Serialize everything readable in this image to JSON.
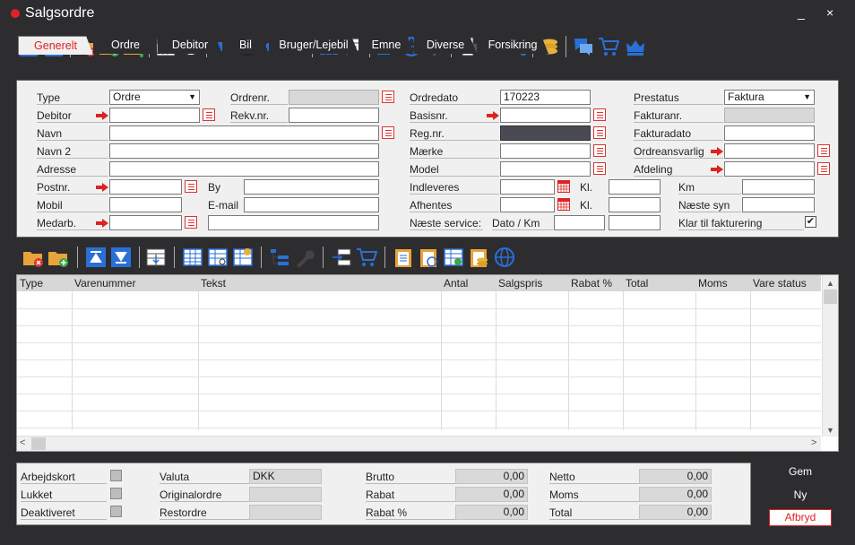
{
  "window": {
    "title": "Salgsordre",
    "minimize": "_",
    "close": "×"
  },
  "tabs": [
    "Generelt",
    "Ordre",
    "Debitor",
    "Bil",
    "Bruger/Lejebil",
    "Emne",
    "Diverse",
    "Forsikring"
  ],
  "header": {
    "type_label": "Type",
    "type_value": "Ordre",
    "ordrenr_label": "Ordrenr.",
    "debitor_label": "Debitor",
    "rekvnr_label": "Rekv.nr.",
    "navn_label": "Navn",
    "navn2_label": "Navn 2",
    "adresse_label": "Adresse",
    "postnr_label": "Postnr.",
    "by_label": "By",
    "mobil_label": "Mobil",
    "email_label": "E-mail",
    "medarb_label": "Medarb.",
    "ordredato_label": "Ordredato",
    "ordredato_value": "170223",
    "basisnr_label": "Basisnr.",
    "regnr_label": "Reg.nr.",
    "maerke_label": "Mærke",
    "model_label": "Model",
    "indleveres_label": "Indleveres",
    "afhentes_label": "Afhentes",
    "kl_label": "Kl.",
    "kl2_label": "Kl.",
    "naeste_service_label": "Næste service:",
    "dato_km_label": "Dato / Km",
    "prestatus_label": "Prestatus",
    "prestatus_value": "Faktura",
    "fakturanr_label": "Fakturanr.",
    "fakturadato_label": "Fakturadato",
    "ordreansvarlig_label": "Ordreansvarlig",
    "afdeling_label": "Afdeling",
    "km_label": "Km",
    "naeste_syn_label": "Næste syn",
    "klar_label": "Klar til fakturering",
    "klar_checked": "✔"
  },
  "grid": {
    "columns": [
      "Type",
      "Varenummer",
      "Tekst",
      "Antal",
      "Salgspris",
      "Rabat %",
      "Total",
      "Moms",
      "Vare status"
    ],
    "scroll_right": ">"
  },
  "footer": {
    "arbejdskort": "Arbejdskort",
    "lukket": "Lukket",
    "deaktiveret": "Deaktiveret",
    "valuta_label": "Valuta",
    "valuta_value": "DKK",
    "originalordre_label": "Originalordre",
    "restordre_label": "Restordre",
    "brutto_label": "Brutto",
    "brutto_value": "0,00",
    "rabat_label": "Rabat",
    "rabat_value": "0,00",
    "rabatpct_label": "Rabat %",
    "rabatpct_value": "0,00",
    "netto_label": "Netto",
    "netto_value": "0,00",
    "moms_label": "Moms",
    "moms_value": "0,00",
    "total_label": "Total",
    "total_value": "0,00"
  },
  "buttons": {
    "gem": "Gem",
    "ny": "Ny",
    "afbryd": "Afbryd"
  },
  "colors": {
    "accent_blue": "#2a6fd6",
    "dark": "#2d2d30",
    "red": "#e02020"
  }
}
